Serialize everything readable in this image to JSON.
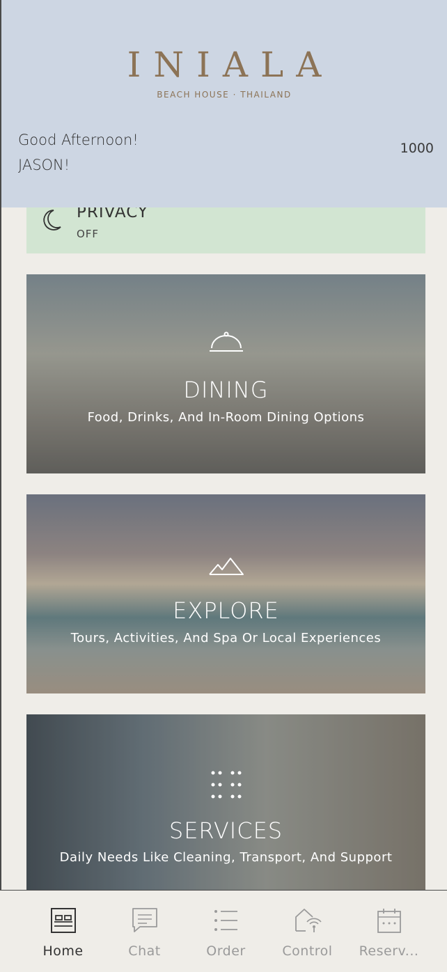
{
  "header": {
    "logo_text": "INIALA",
    "logo_subtitle": "BEACH HOUSE · THAILAND",
    "greeting_line1": "Good Afternoon!",
    "greeting_line2": "JASON!",
    "room_number": "1000"
  },
  "privacy": {
    "title": "PRIVACY",
    "status": "OFF",
    "icon": "moon-icon"
  },
  "cards": [
    {
      "title": "DINING",
      "description": "Food, Drinks, And In-Room Dining Options",
      "icon": "cloche-icon"
    },
    {
      "title": "EXPLORE",
      "description": "Tours, Activities, And Spa Or Local Experiences",
      "icon": "mountain-icon"
    },
    {
      "title": "SERVICES",
      "description": "Daily Needs Like Cleaning, Transport, And Support",
      "icon": "dots-grid-icon"
    }
  ],
  "nav": {
    "items": [
      {
        "label": "Home",
        "icon": "bed-icon",
        "active": true
      },
      {
        "label": "Chat",
        "icon": "chat-icon",
        "active": false
      },
      {
        "label": "Order",
        "icon": "list-icon",
        "active": false
      },
      {
        "label": "Control",
        "icon": "smart-home-icon",
        "active": false
      },
      {
        "label": "Reserv...",
        "icon": "calendar-icon",
        "active": false
      }
    ]
  },
  "colors": {
    "header_bg": "#cdd6e3",
    "logo": "#8c7356",
    "privacy_bg": "#d2e5d2",
    "page_bg": "#efede8"
  }
}
